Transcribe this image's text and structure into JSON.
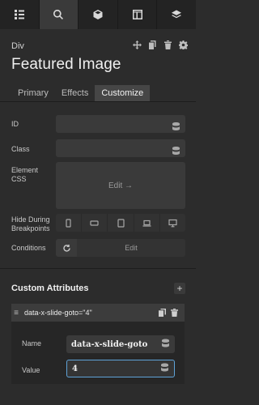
{
  "toolbar": {
    "tabs": [
      {
        "icon": "list-icon"
      },
      {
        "icon": "search-icon",
        "active": true
      },
      {
        "icon": "box-icon"
      },
      {
        "icon": "layout-icon"
      },
      {
        "icon": "layers-icon"
      }
    ]
  },
  "element": {
    "type": "Div",
    "title": "Featured Image"
  },
  "tabs": [
    "Primary",
    "Effects",
    "Customize"
  ],
  "active_tab": "Customize",
  "fields": {
    "id_label": "ID",
    "class_label": "Class",
    "css_label_1": "Element",
    "css_label_2": "CSS",
    "css_edit": "Edit →",
    "hide_label_1": "Hide During",
    "hide_label_2": "Breakpoints",
    "conditions_label": "Conditions",
    "conditions_edit": "Edit"
  },
  "custom_attributes": {
    "title": "Custom Attributes",
    "add_symbol": "+",
    "items": [
      {
        "header": "data-x-slide-goto=\"4\"",
        "name_label": "Name",
        "name_value": "data-x-slide-goto",
        "value_label": "Value",
        "value_value": "4"
      }
    ]
  },
  "colors": {
    "background": "#2c2c2c",
    "field": "#3a3a3a",
    "focus_border": "#5fa3d8"
  }
}
